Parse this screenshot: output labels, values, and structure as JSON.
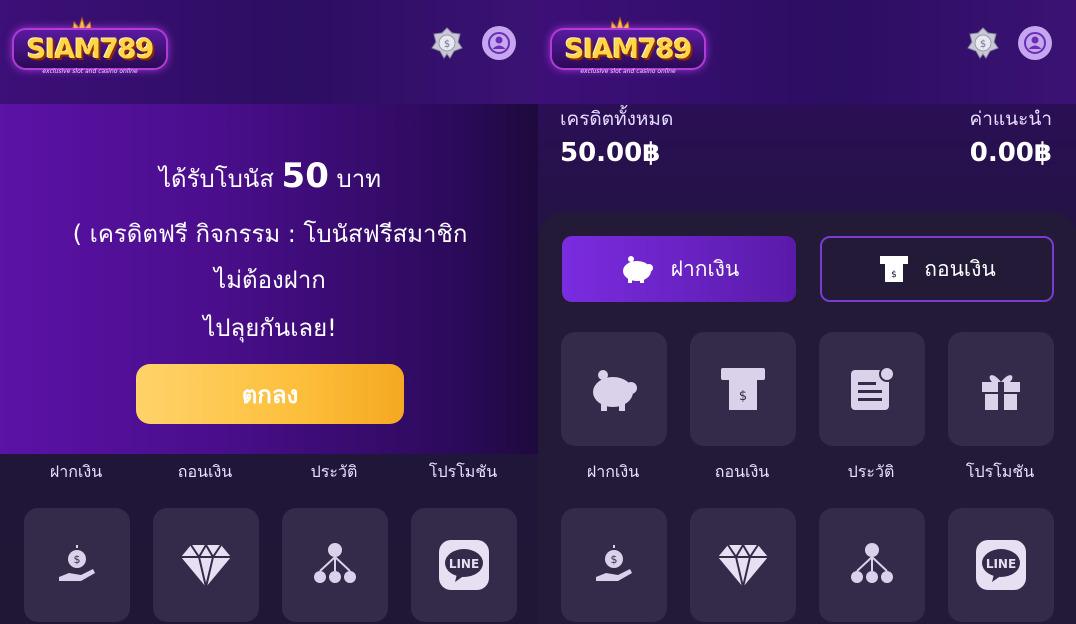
{
  "brand": {
    "name": "SIAM789",
    "tagline": "exclusive slot and casino online"
  },
  "colors": {
    "accent": "#7a2ce0",
    "ok_button": "#fdbf3c",
    "tile": "#342b4a",
    "bg": "#1f1734"
  },
  "popup": {
    "line1_prefix": "ได้รับโบนัส",
    "line1_amount": "50",
    "line1_suffix": "บาท",
    "line2": "( เครดิตฟรี กิจกรรม : โบนัสฟรีสมาชิก",
    "line3": "ไม่ต้องฝาก",
    "line4": "ไปลุยกันเลย!",
    "ok_label": "ตกลง"
  },
  "balance": {
    "credit_label": "เครดิตทั้งหมด",
    "credit_value": "50.00฿",
    "commission_label": "ค่าแนะนำ",
    "commission_value": "0.00฿"
  },
  "actions": {
    "deposit": "ฝากเงิน",
    "withdraw": "ถอนเงิน"
  },
  "menu_labels": [
    "ฝากเงิน",
    "ถอนเงิน",
    "ประวัติ",
    "โปรโมชัน"
  ],
  "icons": {
    "row1": [
      "piggy-bank-icon",
      "atm-withdraw-icon",
      "history-icon",
      "gift-icon"
    ],
    "row2": [
      "money-hand-icon",
      "diamond-icon",
      "referral-icon",
      "line-icon"
    ]
  },
  "line_text": "LINE"
}
